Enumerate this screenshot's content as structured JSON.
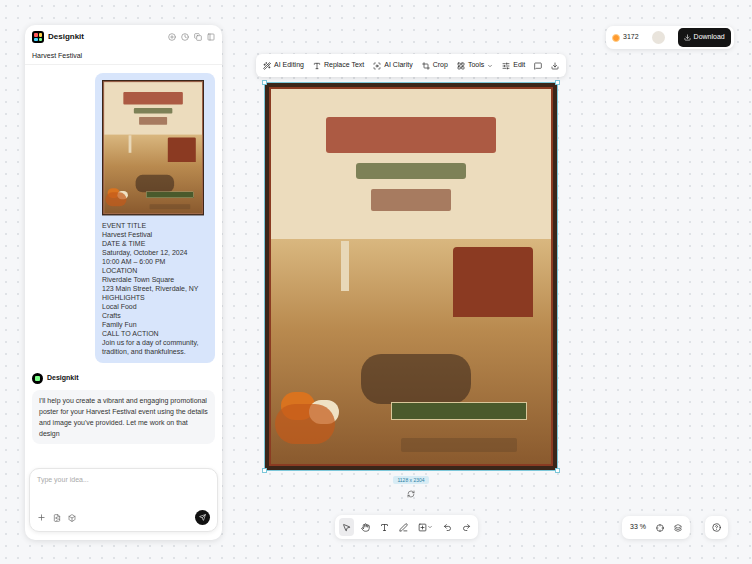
{
  "app": {
    "name": "Designkit"
  },
  "chat": {
    "title": "Harvest Festival",
    "user_message": {
      "lines": [
        "EVENT TITLE",
        "Harvest Festival",
        "DATE & TIME",
        "Saturday, October 12, 2024",
        "10:00 AM – 6:00 PM",
        "LOCATION",
        "Riverdale Town Square",
        "123 Main Street, Riverdale, NY",
        "HIGHLIGHTS",
        "Local Food",
        "Crafts",
        "Family Fun",
        "CALL TO ACTION",
        "Join us for a day of community, tradition, and thankfulness."
      ]
    },
    "assistant": {
      "name": "Designkit",
      "text": "I'll help you create a vibrant and engaging promotional poster for your Harvest Festival event using the details and image you've provided. Let me work on that design"
    },
    "input": {
      "placeholder": "Type your idea..."
    }
  },
  "toolbar": {
    "items": [
      {
        "kind": "ai-editing",
        "label": "AI Editing",
        "dropdown": false
      },
      {
        "kind": "replace-text",
        "label": "Replace Text",
        "dropdown": false
      },
      {
        "kind": "ai-clarity",
        "label": "AI Clarity",
        "dropdown": false
      },
      {
        "kind": "crop",
        "label": "Crop",
        "dropdown": false
      },
      {
        "kind": "tools",
        "label": "Tools",
        "dropdown": true
      },
      {
        "kind": "edit",
        "label": "Edit",
        "dropdown": false
      },
      {
        "kind": "comment",
        "label": "",
        "dropdown": false
      },
      {
        "kind": "download",
        "label": "",
        "dropdown": false
      }
    ]
  },
  "account": {
    "credits": "3172",
    "download": "Download"
  },
  "canvas": {
    "size_label": "1128 x 2304",
    "selected": true
  },
  "bottom_toolbar": {
    "tools": [
      {
        "kind": "select",
        "selected": true
      },
      {
        "kind": "hand",
        "selected": false
      },
      {
        "kind": "text",
        "selected": false
      },
      {
        "kind": "pen",
        "selected": false
      },
      {
        "kind": "shape",
        "selected": false
      },
      {
        "kind": "undo",
        "selected": false
      },
      {
        "kind": "redo",
        "selected": false
      }
    ]
  },
  "zoom": {
    "value": "33 %"
  }
}
